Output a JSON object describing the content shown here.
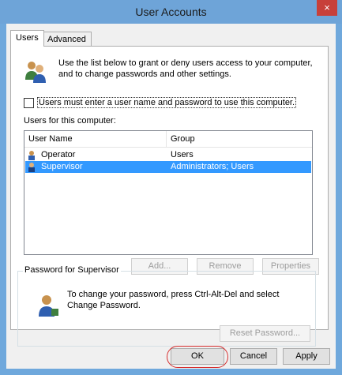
{
  "window": {
    "title": "User Accounts",
    "close_label": "×"
  },
  "tabs": [
    {
      "label": "Users"
    },
    {
      "label": "Advanced"
    }
  ],
  "intro_text": "Use the list below to grant or deny users access to your computer, and to change passwords and other settings.",
  "checkbox": {
    "label": "Users must enter a user name and password to use this computer.",
    "checked": false
  },
  "list": {
    "title": "Users for this computer:",
    "columns": [
      "User Name",
      "Group"
    ],
    "rows": [
      {
        "name": "Operator",
        "group": "Users",
        "selected": false
      },
      {
        "name": "Supervisor",
        "group": "Administrators; Users",
        "selected": true
      }
    ]
  },
  "list_buttons": {
    "add": "Add...",
    "remove": "Remove",
    "properties": "Properties"
  },
  "password_group": {
    "title": "Password for Supervisor",
    "text": "To change your password, press Ctrl-Alt-Del and select Change Password.",
    "reset_button": "Reset Password..."
  },
  "dialog_buttons": {
    "ok": "OK",
    "cancel": "Cancel",
    "apply": "Apply"
  },
  "colors": {
    "title_bar": "#6ea4d8",
    "selection": "#3399ff",
    "close": "#c7403a",
    "annotation": "#d62f2f"
  }
}
